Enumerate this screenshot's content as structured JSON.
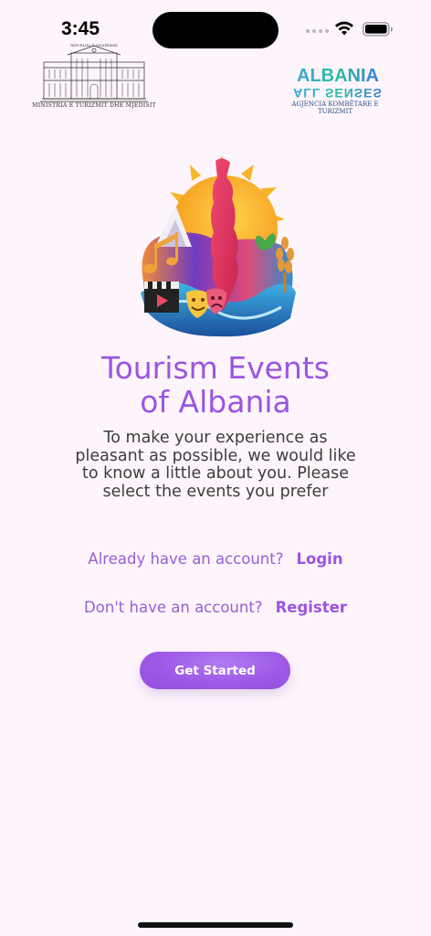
{
  "status_bar": {
    "time": "3:45"
  },
  "header": {
    "ministry_small": "REPUBLIKA E SHQIPËRISË",
    "ministry_caption": "MINISTRIA E TURIZMIT DHE MJEDISIT",
    "albania_logo_text": "ALBANIA",
    "all_senses_text": "ALL SENSES",
    "agency_caption": "AGJENCIA KOMBËTARE E TURIZMIT"
  },
  "main": {
    "title_line1": "Tourism Events",
    "title_line2": "of Albania",
    "subtitle": "To make your experience as pleasant as possible, we would like to know a little about you. Please select the events you prefer",
    "login_prompt": "Already have an account?",
    "login_label": "Login",
    "register_prompt": "Don't have an account?",
    "register_label": "Register",
    "cta_label": "Get Started"
  },
  "colors": {
    "accent": "#9b55e0",
    "background": "#fdf5fb",
    "button": "#9e58e6",
    "text": "#3d3d3d"
  }
}
